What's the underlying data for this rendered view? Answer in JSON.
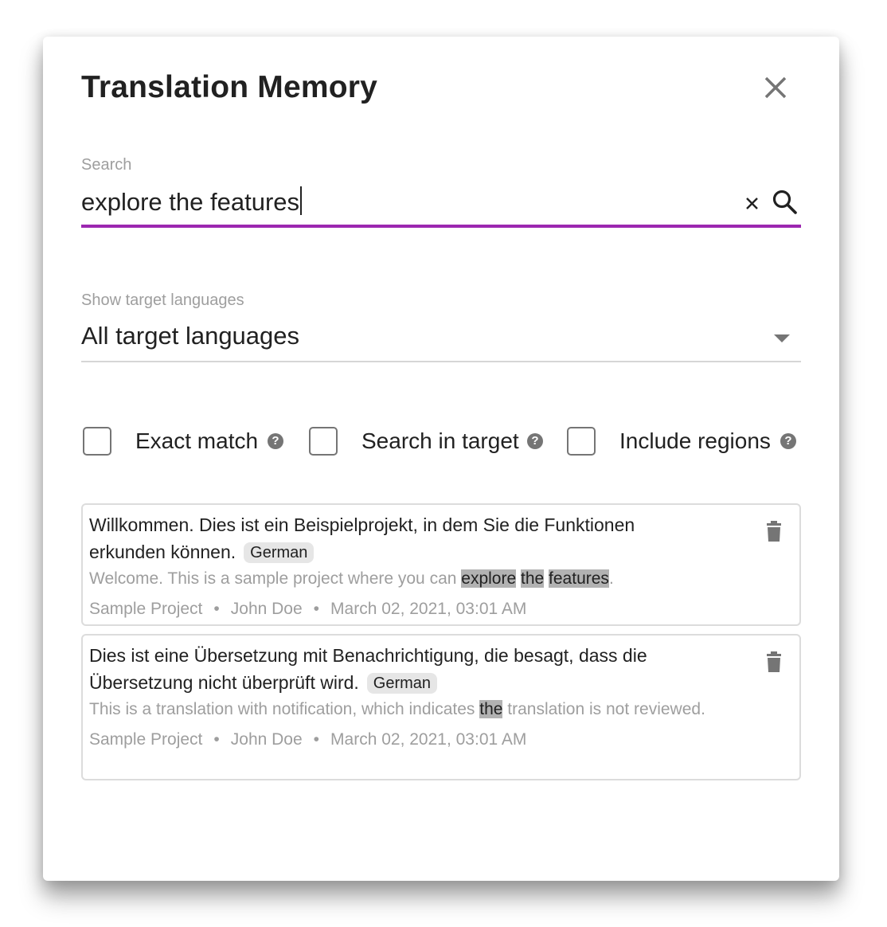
{
  "dialog": {
    "title": "Translation Memory",
    "close_icon": "close-icon"
  },
  "search": {
    "label": "Search",
    "value": "explore the features",
    "accent_color": "#9c27b0",
    "clear_icon": "clear-icon",
    "search_icon": "search-icon"
  },
  "language_select": {
    "label": "Show target languages",
    "selected": "All target languages",
    "arrow_icon": "dropdown-arrow-icon"
  },
  "options": [
    {
      "label": "Exact match",
      "checked": false,
      "help_icon": "help-icon"
    },
    {
      "label": "Search in target",
      "checked": false,
      "help_icon": "help-icon"
    },
    {
      "label": "Include regions",
      "checked": false,
      "help_icon": "help-icon"
    }
  ],
  "results": [
    {
      "source": "Willkommen. Dies ist ein Beispielprojekt, in dem Sie die Funktionen erkunden können.",
      "language": "German",
      "target_parts": [
        {
          "text": "Welcome. This is a sample project where you can ",
          "hl": false
        },
        {
          "text": "explore",
          "hl": true
        },
        {
          "text": " ",
          "hl": false
        },
        {
          "text": "the",
          "hl": true
        },
        {
          "text": " ",
          "hl": false
        },
        {
          "text": "features",
          "hl": true
        },
        {
          "text": ".",
          "hl": false
        }
      ],
      "project": "Sample Project",
      "user": "John Doe",
      "date": "March 02, 2021, 03:01 AM",
      "separator": "•"
    },
    {
      "source": "Dies ist eine Übersetzung mit Benachrichtigung, die besagt, dass die Übersetzung nicht überprüft wird.",
      "language": "German",
      "target_parts": [
        {
          "text": "This is a translation with notification, which indicates ",
          "hl": false
        },
        {
          "text": "the",
          "hl": true
        },
        {
          "text": " translation is not reviewed.",
          "hl": false
        }
      ],
      "project": "Sample Project",
      "user": "John Doe",
      "date": "March 02, 2021, 03:01 AM",
      "separator": "•"
    }
  ]
}
